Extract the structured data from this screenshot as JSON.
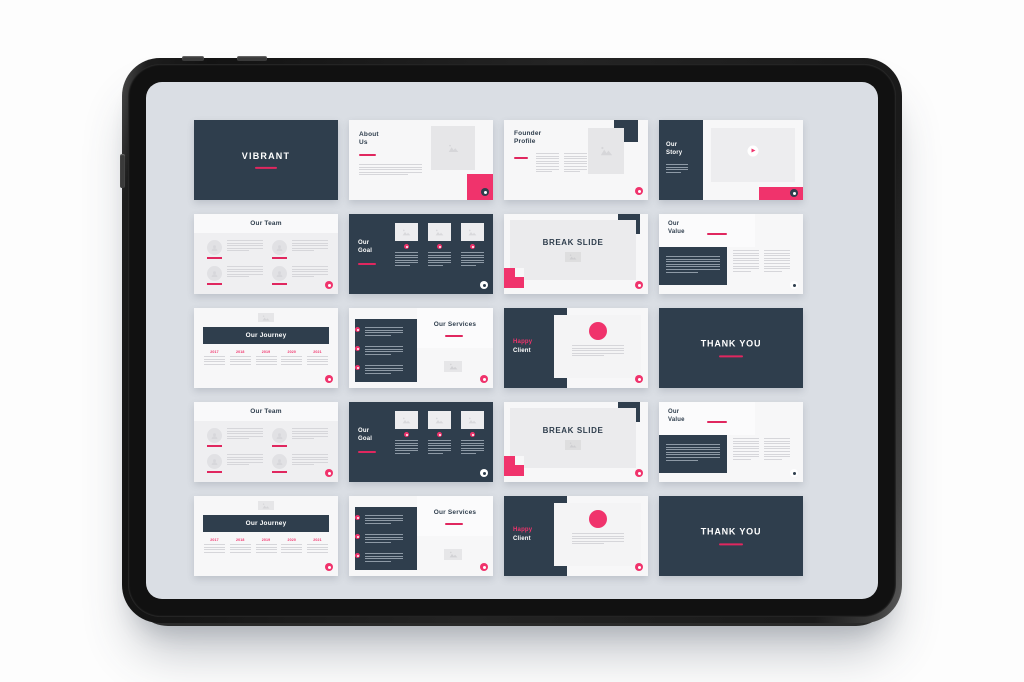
{
  "device": {
    "name": "tablet-mockup",
    "screen_background": "#dadee4",
    "body_color": "#1d1d1d"
  },
  "theme": {
    "dark": "#2f3e4d",
    "pink": "#f0336c",
    "light": "#f7f7f8",
    "rule": "#e0275f"
  },
  "slides": [
    {
      "id": "title-slide",
      "title": "VIBRANT"
    },
    {
      "id": "about-us",
      "title_line1": "About",
      "title_line2": "Us"
    },
    {
      "id": "founder-profile",
      "title_line1": "Founder",
      "title_line2": "Profile"
    },
    {
      "id": "our-story",
      "title_line1": "Our",
      "title_line2": "Story"
    },
    {
      "id": "our-team-1",
      "title": "Our Team"
    },
    {
      "id": "our-goal-1",
      "title_line1": "Our",
      "title_line2": "Goal"
    },
    {
      "id": "break-slide-1",
      "title": "BREAK SLIDE"
    },
    {
      "id": "our-value-1",
      "title_line1": "Our",
      "title_line2": "Value"
    },
    {
      "id": "our-journey-1",
      "title": "Our Journey",
      "years": [
        "2017",
        "2018",
        "2019",
        "2020",
        "2021"
      ]
    },
    {
      "id": "our-services-1",
      "title": "Our Services"
    },
    {
      "id": "happy-client-1",
      "title_line1": "Happy",
      "title_line2": "Client"
    },
    {
      "id": "thank-you-1",
      "title": "THANK YOU"
    },
    {
      "id": "our-team-2",
      "title": "Our Team"
    },
    {
      "id": "our-goal-2",
      "title_line1": "Our",
      "title_line2": "Goal"
    },
    {
      "id": "break-slide-2",
      "title": "BREAK SLIDE"
    },
    {
      "id": "our-value-2",
      "title_line1": "Our",
      "title_line2": "Value"
    },
    {
      "id": "our-journey-2",
      "title": "Our Journey",
      "years": [
        "2017",
        "2018",
        "2019",
        "2020",
        "2021"
      ]
    },
    {
      "id": "our-services-2",
      "title": "Our Services"
    },
    {
      "id": "happy-client-2",
      "title_line1": "Happy",
      "title_line2": "Client"
    },
    {
      "id": "thank-you-2",
      "title": "THANK YOU"
    }
  ]
}
